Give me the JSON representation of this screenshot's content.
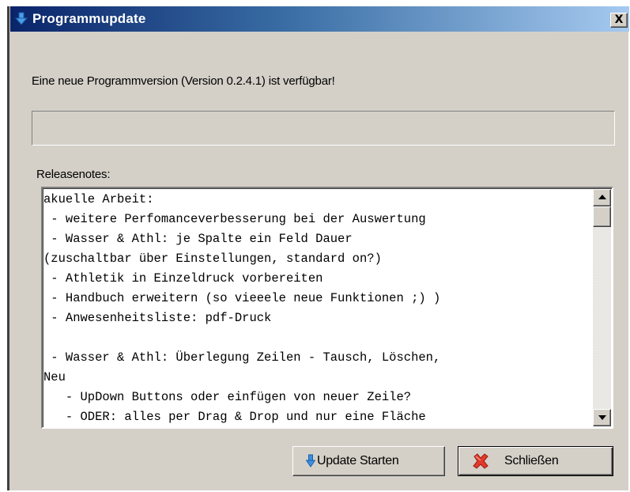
{
  "window": {
    "title": "Programmupdate",
    "close_glyph": "X",
    "title_icon": "download-arrow-icon"
  },
  "message": "Eine neue Programmversion (Version 0.2.4.1) ist verfügbar!",
  "progress": {
    "value_percent": 0
  },
  "release_notes": {
    "label": "Releasenotes:",
    "lines": [
      "akuelle Arbeit:",
      " - weitere Perfomanceverbesserung bei der Auswertung",
      " - Wasser & Athl: je Spalte ein Feld Dauer",
      "(zuschaltbar über Einstellungen, standard on?)",
      " - Athletik in Einzeldruck vorbereiten",
      " - Handbuch erweitern (so vieeele neue Funktionen ;) )",
      " - Anwesenheitsliste: pdf-Druck",
      "",
      " - Wasser & Athl: Überlegung Zeilen - Tausch, Löschen,",
      "Neu",
      "   - UpDown Buttons oder einfügen von neuer Zeile?",
      "   - ODER: alles per Drag & Drop und nur eine Fläche"
    ]
  },
  "buttons": {
    "update": {
      "label": "Update Starten",
      "icon": "download-arrow-icon"
    },
    "close": {
      "label": "Schließen",
      "icon": "red-x-icon"
    }
  },
  "colors": {
    "titlebar_start": "#0a246a",
    "titlebar_end": "#a6caf0",
    "dialog_face": "#d4d0c8"
  }
}
